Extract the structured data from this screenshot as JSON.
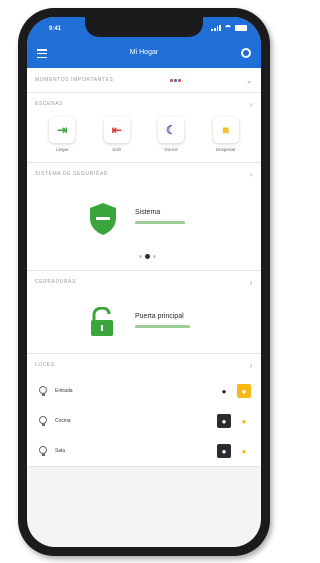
{
  "status_bar": {
    "time": "9:41"
  },
  "app_bar": {
    "title": "Mi Hogar",
    "menu_icon": "menu-icon",
    "settings_icon": "gear-icon"
  },
  "colors": {
    "primary": "#1f6fd6",
    "secure": "#3aa53a",
    "scene_green": "#3aa53a",
    "scene_red": "#d43c3c",
    "scene_purple": "#6a4cc2",
    "scene_yellow": "#f2c230",
    "light_on": "#f6b915"
  },
  "important": {
    "header": "Momentos importantes"
  },
  "scenes": {
    "header": "Escenas",
    "items": [
      {
        "label": "Llegar",
        "icon": "arrive-icon",
        "glyph": "⇥"
      },
      {
        "label": "Salir",
        "icon": "leave-icon",
        "glyph": "⇤"
      },
      {
        "label": "Dormir",
        "icon": "moon-icon",
        "glyph": "☾"
      },
      {
        "label": "Despertar",
        "icon": "sun-icon",
        "glyph": "■"
      }
    ]
  },
  "security": {
    "header": "Sistema de seguridad",
    "title": "Sistema",
    "status_icon": "shield-check-icon"
  },
  "locks": {
    "header": "Cerraduras",
    "title": "Puerta principal",
    "status_icon": "unlocked-icon"
  },
  "lights": {
    "header": "Luces",
    "items": [
      {
        "name": "Entrada",
        "on": true
      },
      {
        "name": "Cocina",
        "on": false
      },
      {
        "name": "Sala",
        "on": false
      }
    ]
  }
}
